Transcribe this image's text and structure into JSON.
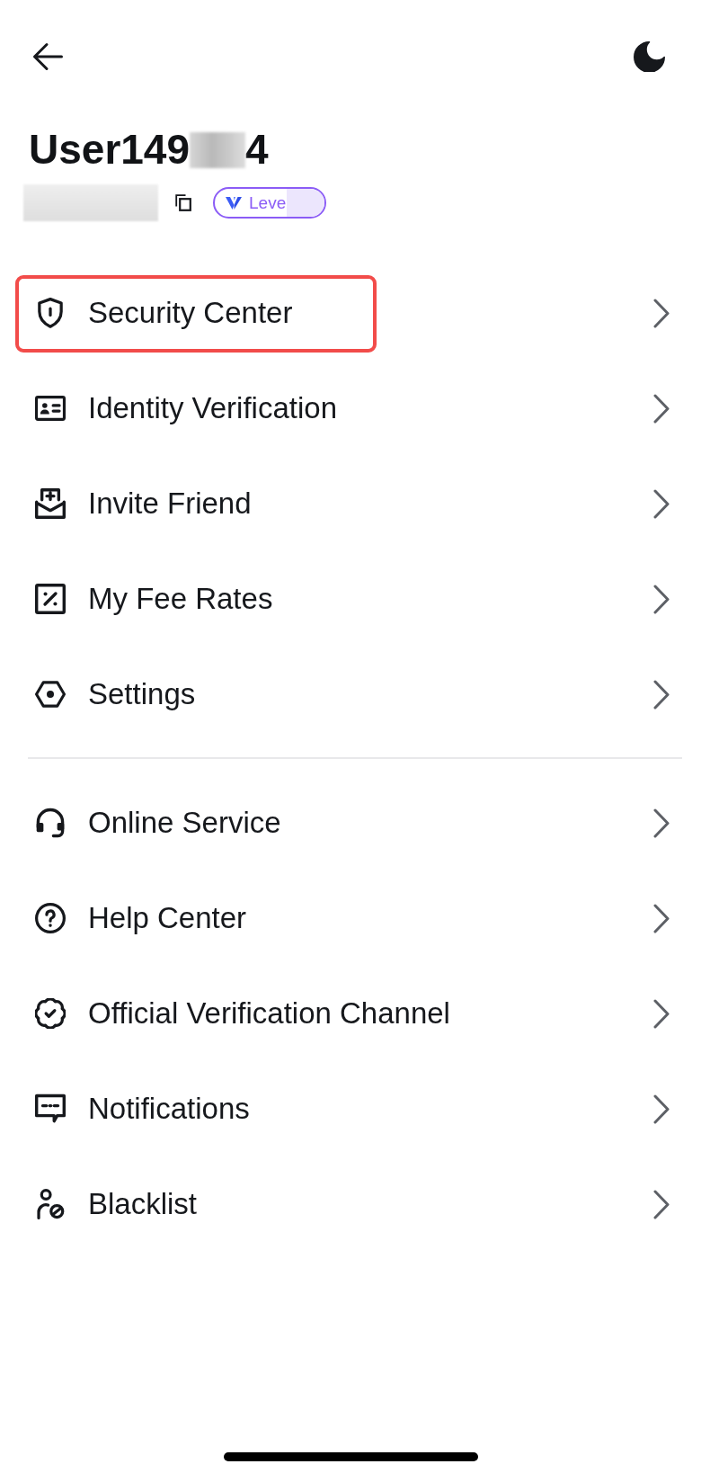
{
  "profile": {
    "username_start": "User149",
    "username_end": "4",
    "level_badge": {
      "label": "Leve"
    }
  },
  "menu_groups": [
    {
      "items": [
        {
          "label": "Security Center",
          "kind": "security",
          "highlighted": true
        },
        {
          "label": "Identity Verification",
          "kind": "identity",
          "highlighted": false
        },
        {
          "label": "Invite Friend",
          "kind": "invite",
          "highlighted": false
        },
        {
          "label": "My Fee Rates",
          "kind": "fees",
          "highlighted": false
        },
        {
          "label": "Settings",
          "kind": "settings",
          "highlighted": false
        }
      ]
    },
    {
      "items": [
        {
          "label": "Online Service",
          "kind": "support",
          "highlighted": false
        },
        {
          "label": "Help Center",
          "kind": "help",
          "highlighted": false
        },
        {
          "label": "Official Verification Channel",
          "kind": "official",
          "highlighted": false
        },
        {
          "label": "Notifications",
          "kind": "notifications",
          "highlighted": false
        },
        {
          "label": "Blacklist",
          "kind": "blacklist",
          "highlighted": false
        }
      ]
    }
  ]
}
